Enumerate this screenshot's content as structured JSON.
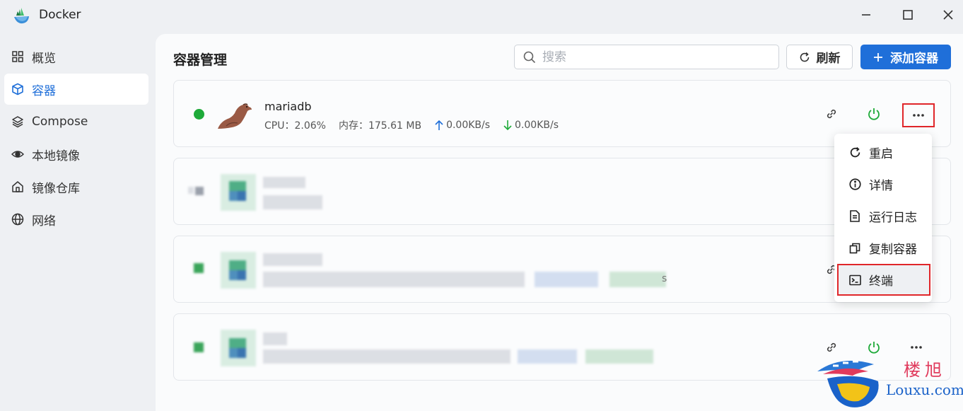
{
  "app": {
    "title": "Docker"
  },
  "sidebar": {
    "items": [
      {
        "label": "概览",
        "icon": "grid-icon",
        "active": false
      },
      {
        "label": "容器",
        "icon": "cube-icon",
        "active": true
      },
      {
        "label": "Compose",
        "icon": "layers-icon",
        "active": false
      },
      {
        "label": "本地镜像",
        "icon": "eye-icon",
        "active": false
      },
      {
        "label": "镜像仓库",
        "icon": "home-icon",
        "active": false
      },
      {
        "label": "网络",
        "icon": "globe-icon",
        "active": false
      }
    ]
  },
  "main": {
    "title": "容器管理",
    "search": {
      "placeholder": "搜索",
      "value": ""
    },
    "refresh_label": "刷新",
    "add_label": "添加容器"
  },
  "containers": [
    {
      "name": "mariadb",
      "status": "running",
      "cpu_label": "CPU：2.06%",
      "mem_label": "内存：175.61 MB",
      "up": "0.00KB/s",
      "down": "0.00KB/s"
    }
  ],
  "menu": {
    "items": [
      {
        "label": "重启",
        "icon": "restart-icon"
      },
      {
        "label": "详情",
        "icon": "info-icon"
      },
      {
        "label": "运行日志",
        "icon": "log-file-icon"
      },
      {
        "label": "复制容器",
        "icon": "copy-icon"
      },
      {
        "label": "终端",
        "icon": "terminal-icon",
        "highlighted": true
      }
    ]
  },
  "partial_text": {
    "card3_suffix": "s"
  },
  "watermark": {
    "cn": "楼旭",
    "en": "Louxu.com"
  },
  "colors": {
    "accent": "#1f6fd9",
    "running": "#1eaa39",
    "highlight": "#e0262a"
  }
}
